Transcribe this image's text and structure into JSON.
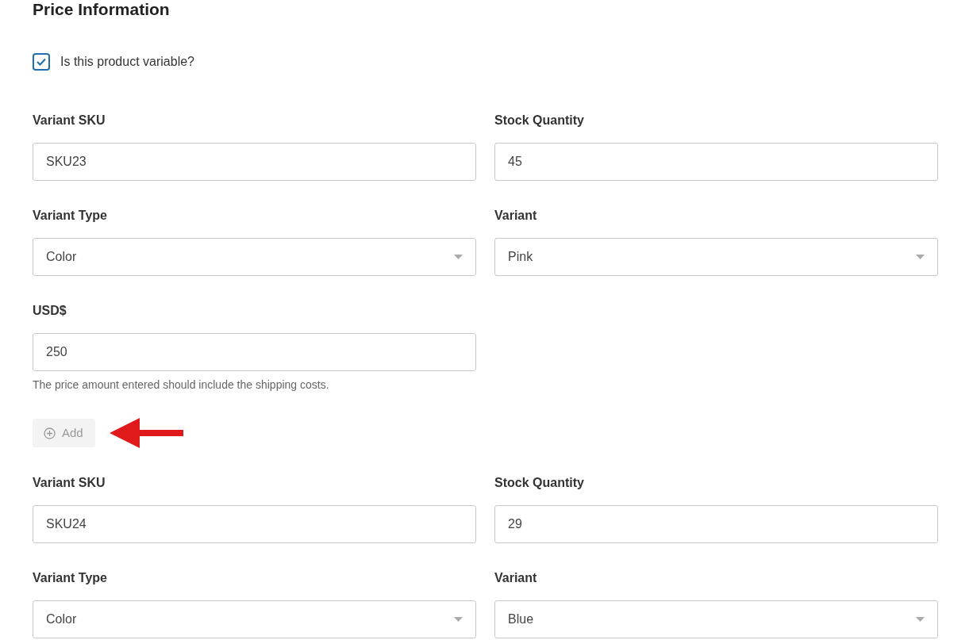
{
  "title": "Price Information",
  "variable_checkbox": {
    "label": "Is this product variable?",
    "checked": true
  },
  "variants": [
    {
      "fields": [
        {
          "kind": "text",
          "label": "Variant SKU",
          "value": "SKU23"
        },
        {
          "kind": "text",
          "label": "Stock Quantity",
          "value": "45"
        },
        {
          "kind": "select",
          "label": "Variant Type",
          "value": "Color"
        },
        {
          "kind": "select",
          "label": "Variant",
          "value": "Pink"
        }
      ],
      "price": {
        "label": "USD$",
        "value": "250",
        "hint": "The price amount entered should include the shipping costs."
      },
      "add_button": {
        "label": "Add",
        "disabled": true
      }
    },
    {
      "fields": [
        {
          "kind": "text",
          "label": "Variant SKU",
          "value": "SKU24"
        },
        {
          "kind": "text",
          "label": "Stock Quantity",
          "value": "29"
        },
        {
          "kind": "select",
          "label": "Variant Type",
          "value": "Color"
        },
        {
          "kind": "select",
          "label": "Variant",
          "value": "Blue"
        }
      ]
    }
  ]
}
